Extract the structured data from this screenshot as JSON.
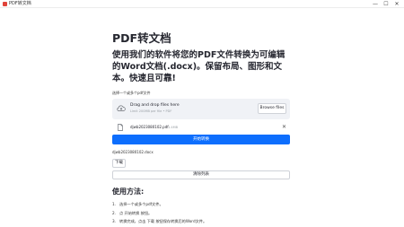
{
  "window": {
    "title": "PDF转文档",
    "controls": {
      "minimize": "—",
      "maximize": "☐",
      "close": "✕"
    }
  },
  "page": {
    "title": "PDF转文档",
    "subtitle": "使用我们的软件将您的PDF文件转换为可编辑的Word文档(.docx)。保留布局、图形和文本。快速且可靠!"
  },
  "uploader": {
    "label": "选择一个或多个pdf文件",
    "dropzone_title": "Drag and drop files here",
    "dropzone_hint": "Limit 200MB per file • PDF",
    "browse_label": "Browse files",
    "file_name": "djwb2023080102.pdf",
    "file_size": "1.4MB"
  },
  "actions": {
    "convert_label": "开始转换",
    "result_file": "djwb2023080102.docx",
    "download_label": "下载",
    "clear_label": "清除列表"
  },
  "usage": {
    "title": "使用方法:",
    "steps": [
      {
        "num": "1.",
        "text": "选择一个或多个pdf文件。"
      },
      {
        "num": "2.",
        "text": "点 开始转换 按钮。"
      },
      {
        "num": "3.",
        "text": "转换完成，点击 下载 按钮保存转换后的Word文件。"
      }
    ]
  },
  "colors": {
    "primary": "#0d6efd",
    "dropzone_bg": "#f0f2f6",
    "text": "#262730",
    "app_icon": "#e0433a"
  }
}
